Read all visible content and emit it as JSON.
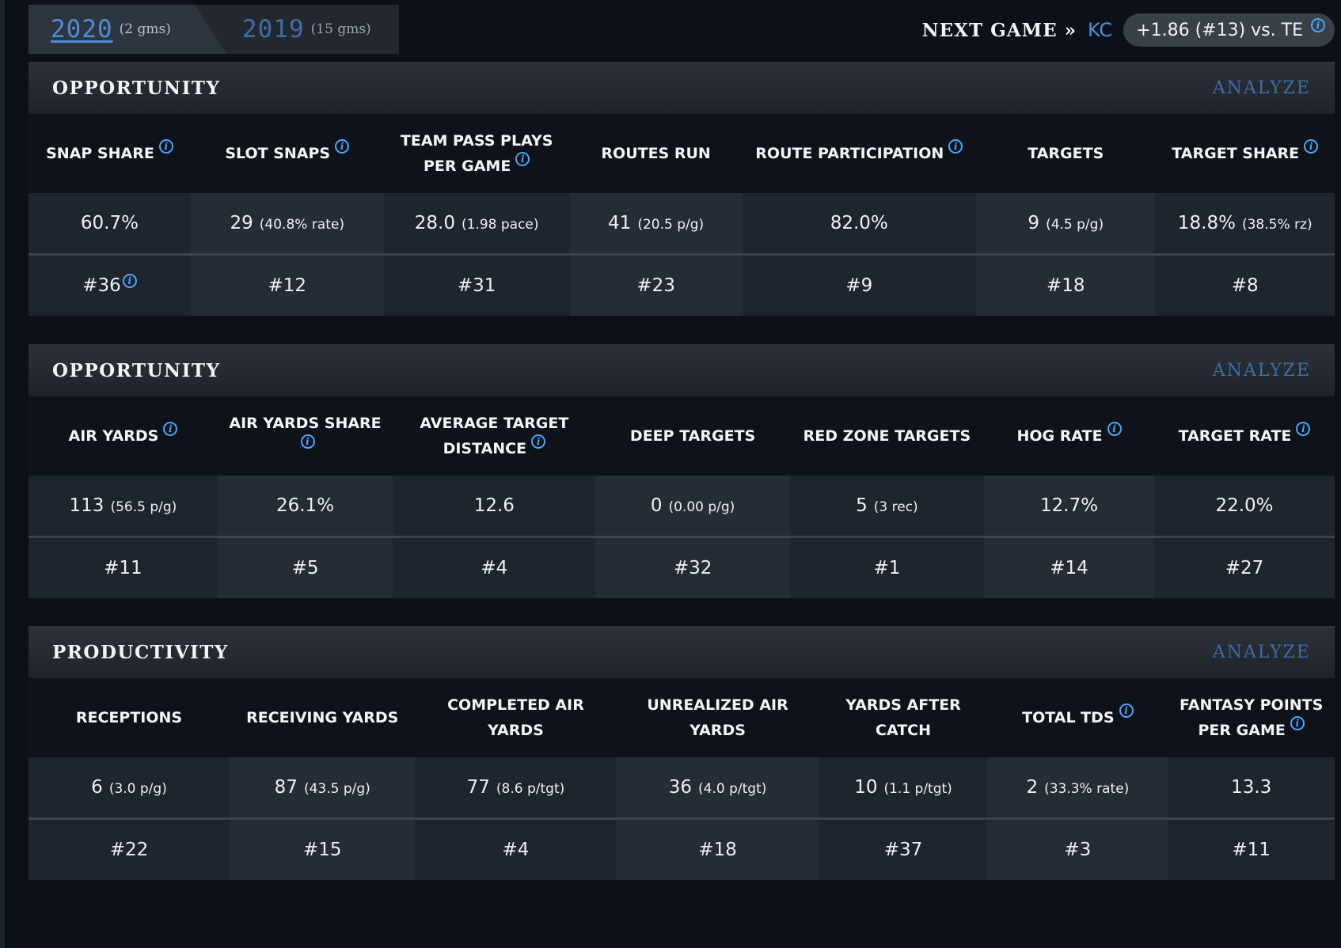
{
  "seasons": [
    {
      "year": "2020",
      "games": "(2 gms)",
      "active": true
    },
    {
      "year": "2019",
      "games": "(15 gms)",
      "active": false
    }
  ],
  "next_game": {
    "label": "NEXT GAME »",
    "team": "KC",
    "matchup": "+1.86 (#13) vs. TE"
  },
  "analyze_label": "ANALYZE",
  "sections": [
    {
      "title": "OPPORTUNITY",
      "columns": [
        "SNAP SHARE",
        "SLOT SNAPS",
        "TEAM PASS PLAYS PER GAME",
        "ROUTES RUN",
        "ROUTE PARTICIPATION",
        "TARGETS",
        "TARGET SHARE"
      ],
      "values": [
        {
          "main": "60.7%",
          "sub": ""
        },
        {
          "main": "29",
          "sub": "(40.8% rate)"
        },
        {
          "main": "28.0",
          "sub": "(1.98 pace)"
        },
        {
          "main": "41",
          "sub": "(20.5 p/g)"
        },
        {
          "main": "82.0%",
          "sub": ""
        },
        {
          "main": "9",
          "sub": "(4.5 p/g)"
        },
        {
          "main": "18.8%",
          "sub": "(38.5% rz)"
        }
      ],
      "ranks": [
        "#36",
        "#12",
        "#31",
        "#23",
        "#9",
        "#18",
        "#8"
      ]
    },
    {
      "title": "OPPORTUNITY",
      "columns": [
        "AIR YARDS",
        "AIR YARDS SHARE",
        "AVERAGE TARGET DISTANCE",
        "DEEP TARGETS",
        "RED ZONE TARGETS",
        "HOG RATE",
        "TARGET RATE"
      ],
      "values": [
        {
          "main": "113",
          "sub": "(56.5 p/g)"
        },
        {
          "main": "26.1%",
          "sub": ""
        },
        {
          "main": "12.6",
          "sub": ""
        },
        {
          "main": "0",
          "sub": "(0.00 p/g)"
        },
        {
          "main": "5",
          "sub": "(3 rec)"
        },
        {
          "main": "12.7%",
          "sub": ""
        },
        {
          "main": "22.0%",
          "sub": ""
        }
      ],
      "ranks": [
        "#11",
        "#5",
        "#4",
        "#32",
        "#1",
        "#14",
        "#27"
      ]
    },
    {
      "title": "PRODUCTIVITY",
      "columns": [
        "RECEPTIONS",
        "RECEIVING YARDS",
        "COMPLETED AIR YARDS",
        "UNREALIZED AIR YARDS",
        "YARDS AFTER CATCH",
        "TOTAL TDS",
        "FANTASY POINTS PER GAME"
      ],
      "values": [
        {
          "main": "6",
          "sub": "(3.0 p/g)"
        },
        {
          "main": "87",
          "sub": "(43.5 p/g)"
        },
        {
          "main": "77",
          "sub": "(8.6 p/tgt)"
        },
        {
          "main": "36",
          "sub": "(4.0 p/tgt)"
        },
        {
          "main": "10",
          "sub": "(1.1 p/tgt)"
        },
        {
          "main": "2",
          "sub": "(33.3% rate)"
        },
        {
          "main": "13.3",
          "sub": ""
        }
      ],
      "ranks": [
        "#22",
        "#15",
        "#4",
        "#18",
        "#37",
        "#3",
        "#11"
      ]
    }
  ]
}
